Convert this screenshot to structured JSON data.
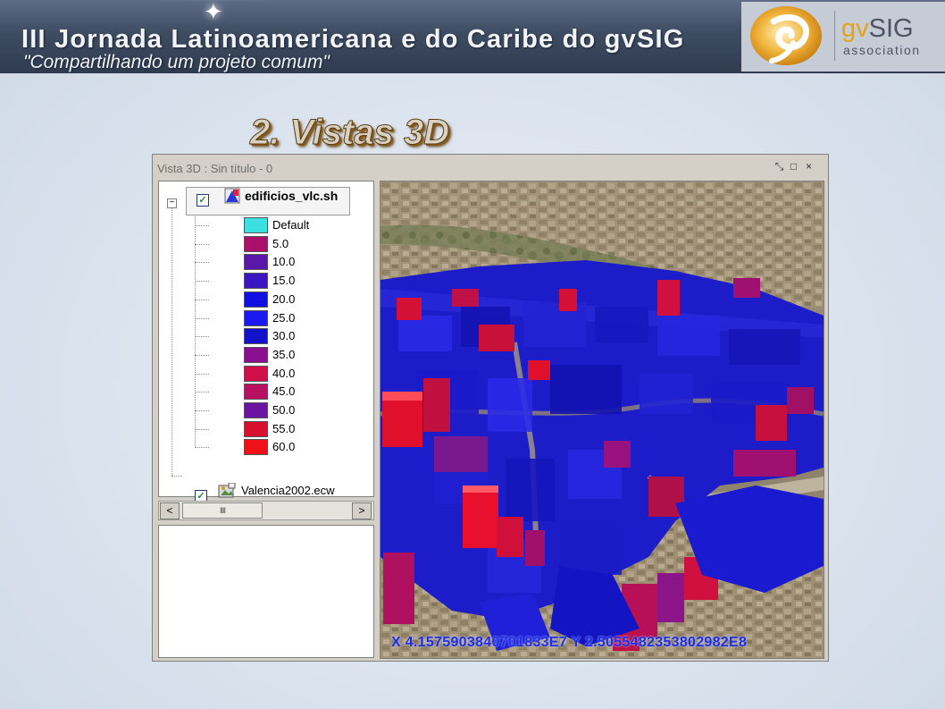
{
  "banner": {
    "title": "III Jornada Latinoamericana e do Caribe do gvSIG",
    "subtitle": "\"Compartilhando um projeto comum\"",
    "logo_name_prefix": "gv",
    "logo_name_suffix": "SIG",
    "logo_sub": "association"
  },
  "slide": {
    "title": "2. Vistas 3D"
  },
  "window": {
    "title": "Vista 3D : Sin título - 0",
    "controls": {
      "restore": "⤡",
      "maximize": "□",
      "close": "×"
    }
  },
  "toc": {
    "expander": "−",
    "layer": {
      "name": "edificios_vlc.sh",
      "checked": true
    },
    "legend": [
      {
        "label": "Default",
        "color": "#3de0e0"
      },
      {
        "label": "5.0",
        "color": "#a8106a"
      },
      {
        "label": "10.0",
        "color": "#5a18a8"
      },
      {
        "label": "15.0",
        "color": "#3a16c2"
      },
      {
        "label": "20.0",
        "color": "#1010e0"
      },
      {
        "label": "25.0",
        "color": "#1a1af0"
      },
      {
        "label": "30.0",
        "color": "#1212c8"
      },
      {
        "label": "35.0",
        "color": "#8a1090"
      },
      {
        "label": "40.0",
        "color": "#d0104a"
      },
      {
        "label": "45.0",
        "color": "#b81060"
      },
      {
        "label": "50.0",
        "color": "#6a14a0"
      },
      {
        "label": "55.0",
        "color": "#d81030"
      },
      {
        "label": "60.0",
        "color": "#f01018"
      }
    ],
    "raster": {
      "name": "Valencia2002.ecw",
      "checked": true
    }
  },
  "scrollbar": {
    "left": "<",
    "right": ">",
    "thumb": "IIII"
  },
  "view": {
    "coords": "X 4.1575903840701833E7 Y 2.5055482353802982E8"
  },
  "colors": {
    "accent": "#1d2ee6",
    "logo_highlight": "#e3a31a"
  }
}
